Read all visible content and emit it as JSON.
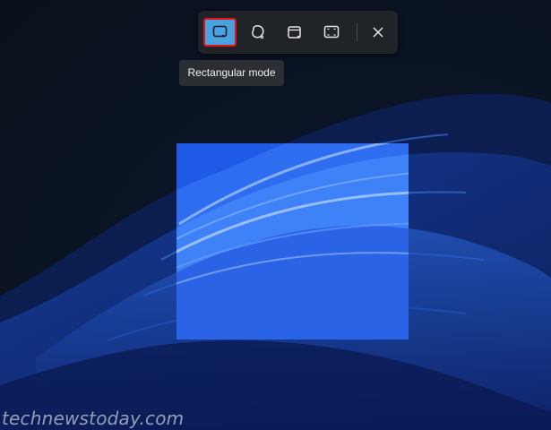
{
  "toolbar": {
    "tools": [
      {
        "name": "Rectangular mode",
        "icon": "rectangle-snip-icon",
        "selected": true
      },
      {
        "name": "Freeform mode",
        "icon": "freeform-snip-icon",
        "selected": false
      },
      {
        "name": "Window mode",
        "icon": "window-snip-icon",
        "selected": false
      },
      {
        "name": "Fullscreen mode",
        "icon": "fullscreen-snip-icon",
        "selected": false
      }
    ],
    "close_icon": "close-icon"
  },
  "tooltip": {
    "text": "Rectangular mode"
  },
  "watermark": {
    "text": "technewstoday.com"
  },
  "colors": {
    "selected_tool": "#4aa3df",
    "highlight_border": "#e0131b",
    "toolbar_bg": "#202327"
  }
}
